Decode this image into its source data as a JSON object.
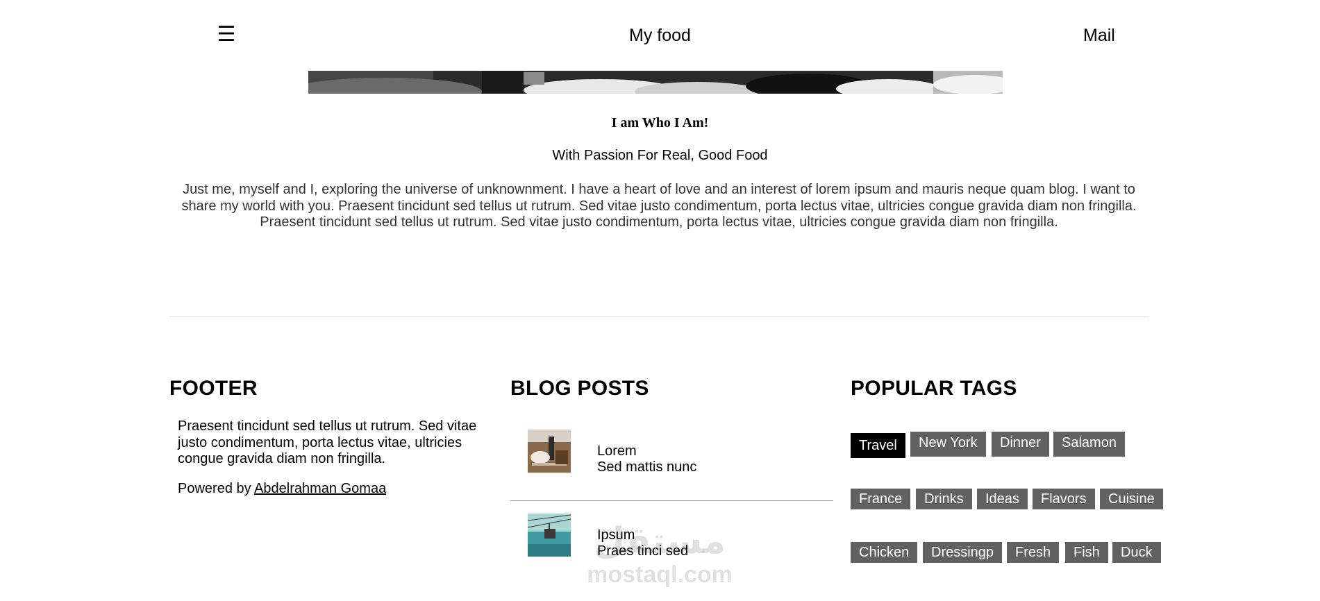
{
  "header": {
    "menu_icon": "☰",
    "site_title": "My food",
    "mail_label": "Mail"
  },
  "hero": {
    "image_desc": "hero-image"
  },
  "about": {
    "heading": "I am Who I Am!",
    "subheading": "With Passion For Real, Good Food",
    "body": "Just me, myself and I, exploring the universe of unknownment. I have a heart of love and an interest of lorem ipsum and mauris neque quam blog. I want to share my world with you. Praesent tincidunt sed tellus ut rutrum. Sed vitae justo condimentum, porta lectus vitae, ultricies congue gravida diam non fringilla. Praesent tincidunt sed tellus ut rutrum. Sed vitae justo condimentum, porta lectus vitae, ultricies congue gravida diam non fringilla."
  },
  "footer": {
    "title": "FOOTER",
    "text": "Praesent tincidunt sed tellus ut rutrum. Sed vitae justo condimentum, porta lectus vitae, ultricies congue gravida diam non fringilla.",
    "powered_prefix": "Powered by ",
    "powered_link": "Abdelrahman Gomaa"
  },
  "blog": {
    "title": "BLOG POSTS",
    "posts": [
      {
        "title": "Lorem",
        "subtitle": "Sed mattis nunc"
      },
      {
        "title": "Ipsum",
        "subtitle": "Praes tinci sed"
      }
    ]
  },
  "tags": {
    "title": "POPULAR TAGS",
    "items": [
      "Travel",
      "New York",
      "Dinner",
      "Salamon",
      "France",
      "Drinks",
      "Ideas",
      "Flavors",
      "Cuisine",
      "Chicken",
      "Dressingp",
      "Fresh",
      "Fish",
      "Duck"
    ],
    "active": "Travel"
  },
  "watermark": {
    "arabic": "مستقل",
    "latin": "mostaql.com"
  },
  "colors": {
    "tag_bg": "#616161",
    "tag_active_bg": "#000000",
    "divider": "#dcdcdc"
  }
}
